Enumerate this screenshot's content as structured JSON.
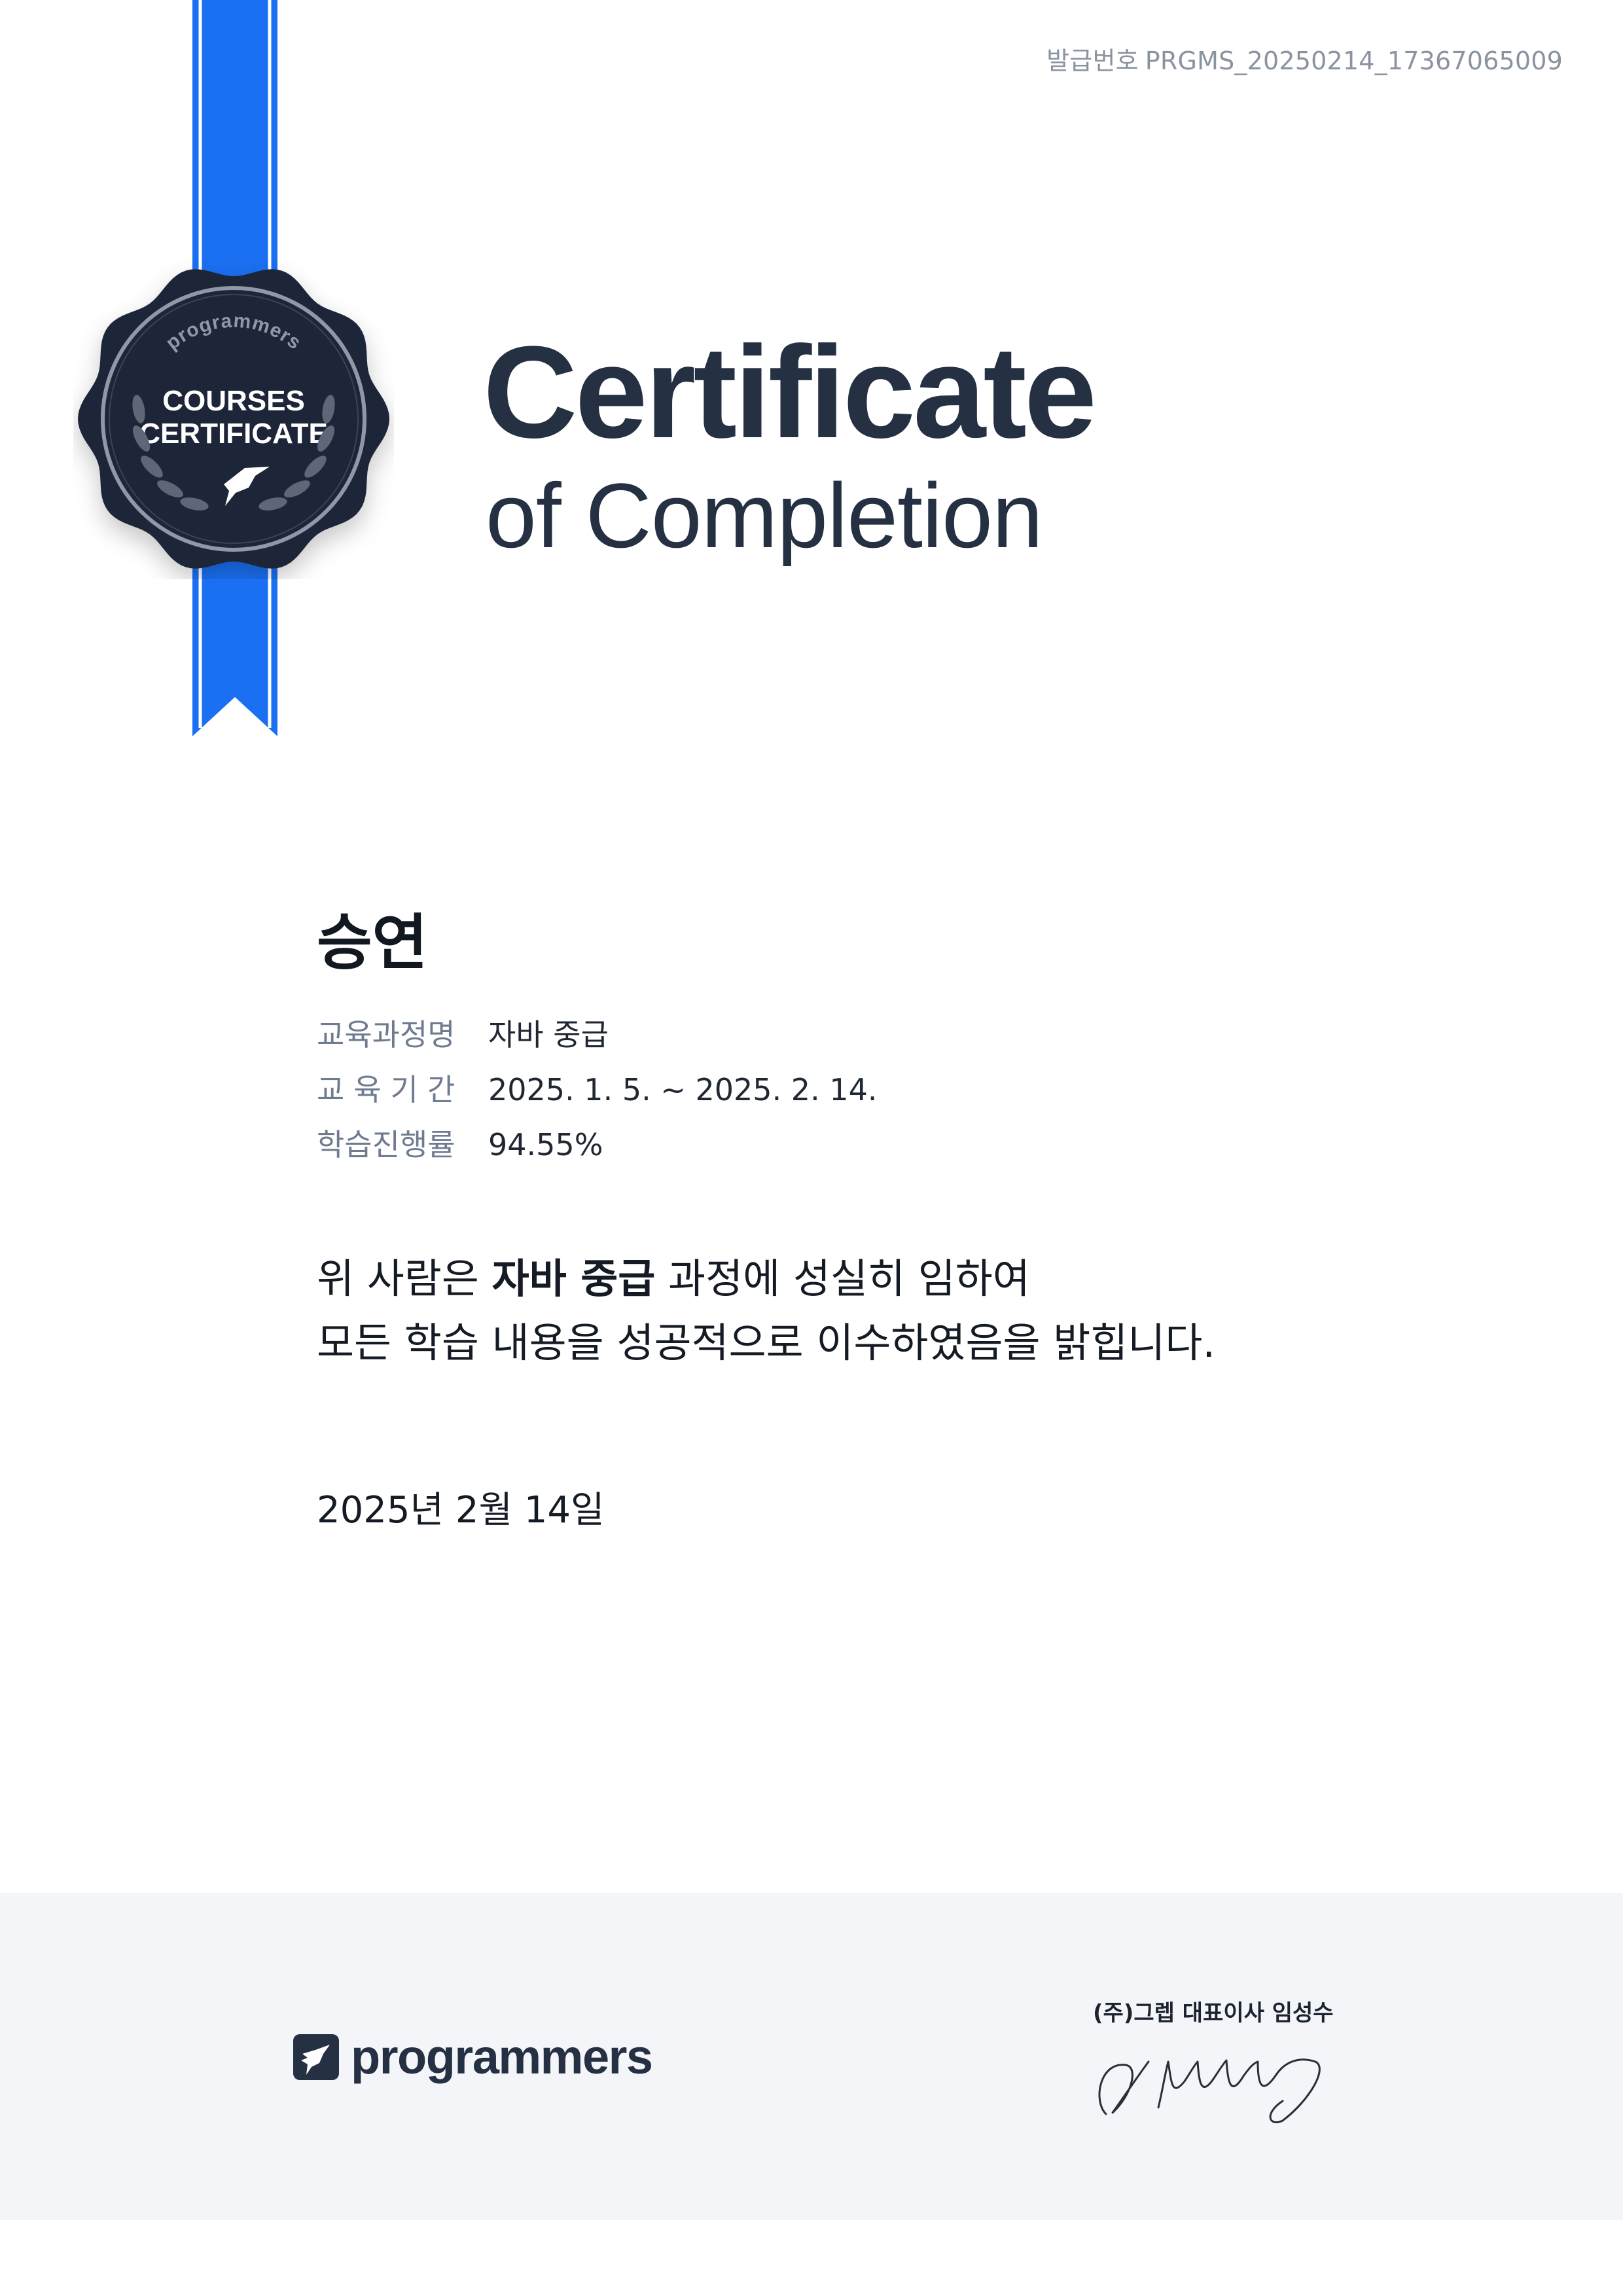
{
  "issue": {
    "label": "발급번호",
    "number": "PRGMS_20250214_17367065009"
  },
  "seal": {
    "brand": "programmers",
    "line1": "COURSES",
    "line2": "CERTIFICATE"
  },
  "title": {
    "main": "Certificate",
    "sub": "of Completion"
  },
  "recipient": {
    "name": "승연"
  },
  "info": [
    {
      "key": "교육과정명",
      "value": "자바 중급"
    },
    {
      "key": "교육기간",
      "value": "2025. 1. 5. ~ 2025. 2. 14."
    },
    {
      "key": "학습진행률",
      "value": "94.55%"
    }
  ],
  "statement": {
    "pre": "위 사람은 ",
    "course": "자바 중급",
    "post": " 과정에 성실히 임하여",
    "line2": "모든 학습 내용을 성공적으로 이수하였음을 밝힙니다."
  },
  "issue_date": "2025년 2월 14일",
  "footer": {
    "brand": "programmers",
    "signer": "(주)그렙 대표이사  임성수"
  },
  "colors": {
    "ribbon": "#1a6ff2",
    "seal": "#1e2838",
    "title": "#253143",
    "footer_bg": "#f4f5f9"
  }
}
